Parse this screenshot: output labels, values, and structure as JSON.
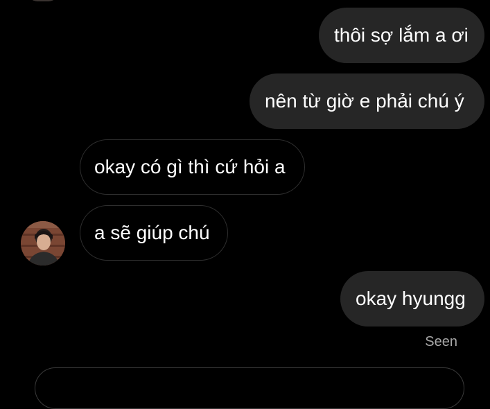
{
  "messages": [
    {
      "sender": "me",
      "text": "thôi sợ lắm a ơi"
    },
    {
      "sender": "me",
      "text": "nên từ giờ e phải chú ý"
    },
    {
      "sender": "other",
      "text": "okay có gì thì cứ hỏi a"
    },
    {
      "sender": "other",
      "text": "a sẽ giúp chú"
    },
    {
      "sender": "me",
      "text": "okay hyungg"
    }
  ],
  "status": {
    "seen_label": "Seen"
  },
  "colors": {
    "background": "#000000",
    "sent_bubble": "#262626",
    "received_border": "#2e2e2e",
    "seen_text": "#a8a8a8"
  },
  "icons": {
    "avatar": "contact-avatar-photo"
  }
}
